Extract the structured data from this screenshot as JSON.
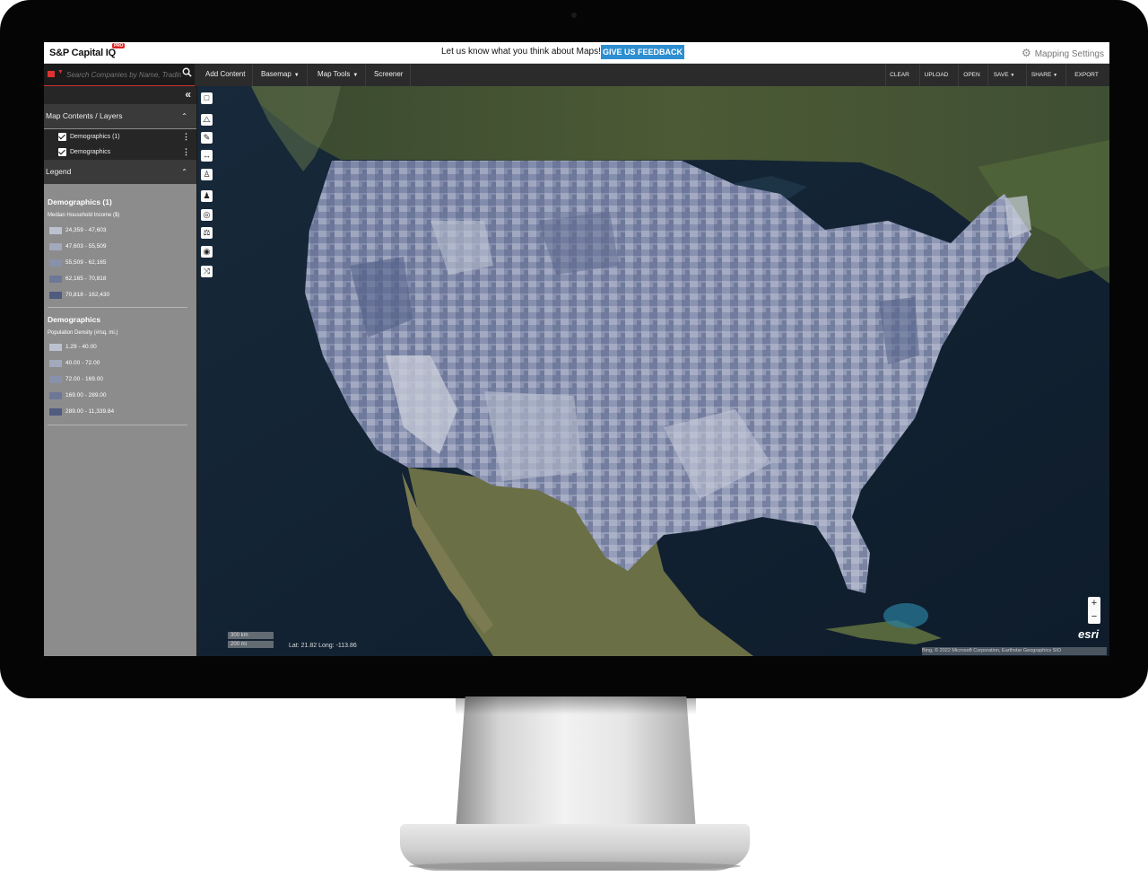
{
  "app": {
    "logo": "S&P Capital IQ",
    "logo_badge": "PRO",
    "feedback_prompt": "Let us know what you think about Maps!",
    "feedback_button": "GIVE US FEEDBACK",
    "settings_label": "Mapping Settings"
  },
  "search": {
    "placeholder": "Search Companies by Name, Trading"
  },
  "menu": [
    "Add Content",
    "Basemap",
    "Map Tools",
    "Screener"
  ],
  "actions": [
    "CLEAR",
    "UPLOAD",
    "OPEN",
    "SAVE",
    "SHARE",
    "EXPORT"
  ],
  "sidebar": {
    "contents_title": "Map Contents / Layers",
    "layers": [
      {
        "label": "Demographics (1)",
        "checked": true
      },
      {
        "label": "Demographics",
        "checked": true
      }
    ],
    "legend_title": "Legend",
    "legends": [
      {
        "title": "Demographics (1)",
        "subtitle": "Median Household Income ($)",
        "classes": [
          {
            "label": "24,359 - 47,603",
            "color": "#bcc1cf"
          },
          {
            "label": "47,603 - 55,509",
            "color": "#a2a9bd"
          },
          {
            "label": "55,509 - 62,165",
            "color": "#8891ab"
          },
          {
            "label": "62,165 - 70,818",
            "color": "#6d7898"
          },
          {
            "label": "70,818 - 162,430",
            "color": "#4f5c80"
          }
        ]
      },
      {
        "title": "Demographics",
        "subtitle": "Population Density (#/sq. mi.)",
        "classes": [
          {
            "label": "1.29 - 40.00",
            "color": "#bcc1cf"
          },
          {
            "label": "40.00 - 72.00",
            "color": "#a2a9bd"
          },
          {
            "label": "72.00 - 169.00",
            "color": "#8891ab"
          },
          {
            "label": "169.00 - 289.00",
            "color": "#6d7898"
          },
          {
            "label": "289.00 - 11,339.84",
            "color": "#4f5c80"
          }
        ]
      }
    ]
  },
  "map": {
    "scale": [
      "300 km",
      "200 mi"
    ],
    "coords": "Lat: 21.82 Long: -113.86",
    "zoom_in": "+",
    "zoom_out": "−",
    "brand": "esri",
    "attribution": "Bing, © 2022 Microsoft Corporation, Earthstar Geographics SIO"
  }
}
